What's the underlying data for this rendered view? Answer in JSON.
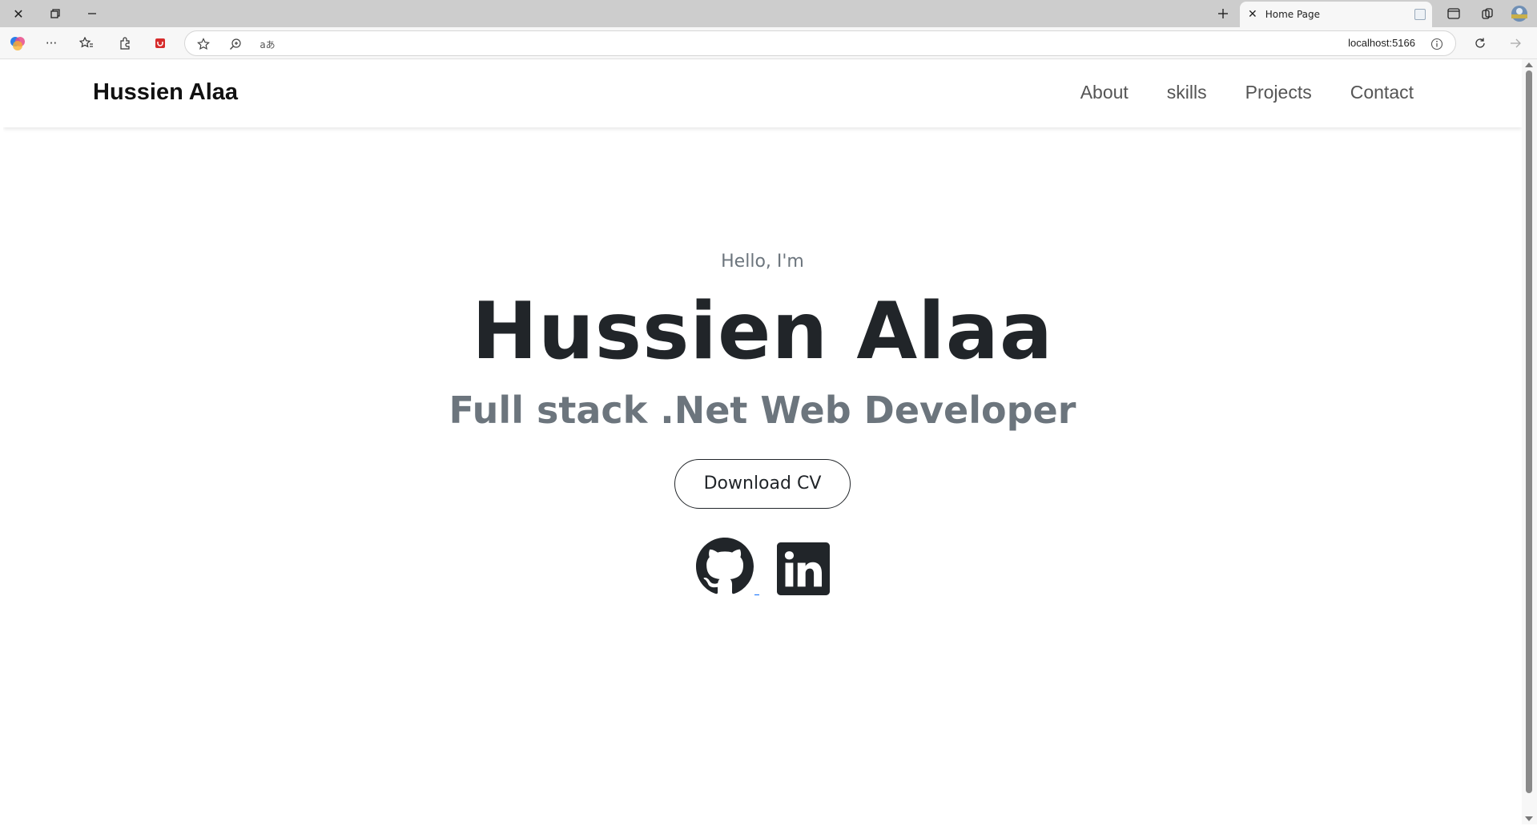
{
  "browser": {
    "tab_title": "Home Page",
    "url": "localhost:5166",
    "icons": {
      "close_window": "close-icon",
      "restore_window": "restore-icon",
      "minimize_window": "minimize-icon",
      "new_tab": "plus-icon"
    }
  },
  "site": {
    "brand": "Hussien Alaa",
    "nav": [
      "About",
      "skills",
      "Projects",
      "Contact"
    ]
  },
  "hero": {
    "greeting": "Hello, I'm",
    "name": "Hussien Alaa",
    "role": "Full stack .Net Web Developer",
    "cta": "Download CV",
    "social": [
      "github-icon",
      "linkedin-icon"
    ]
  },
  "colors": {
    "text_dark": "#212529",
    "text_muted": "#6c757d",
    "link": "#0d6efd"
  }
}
